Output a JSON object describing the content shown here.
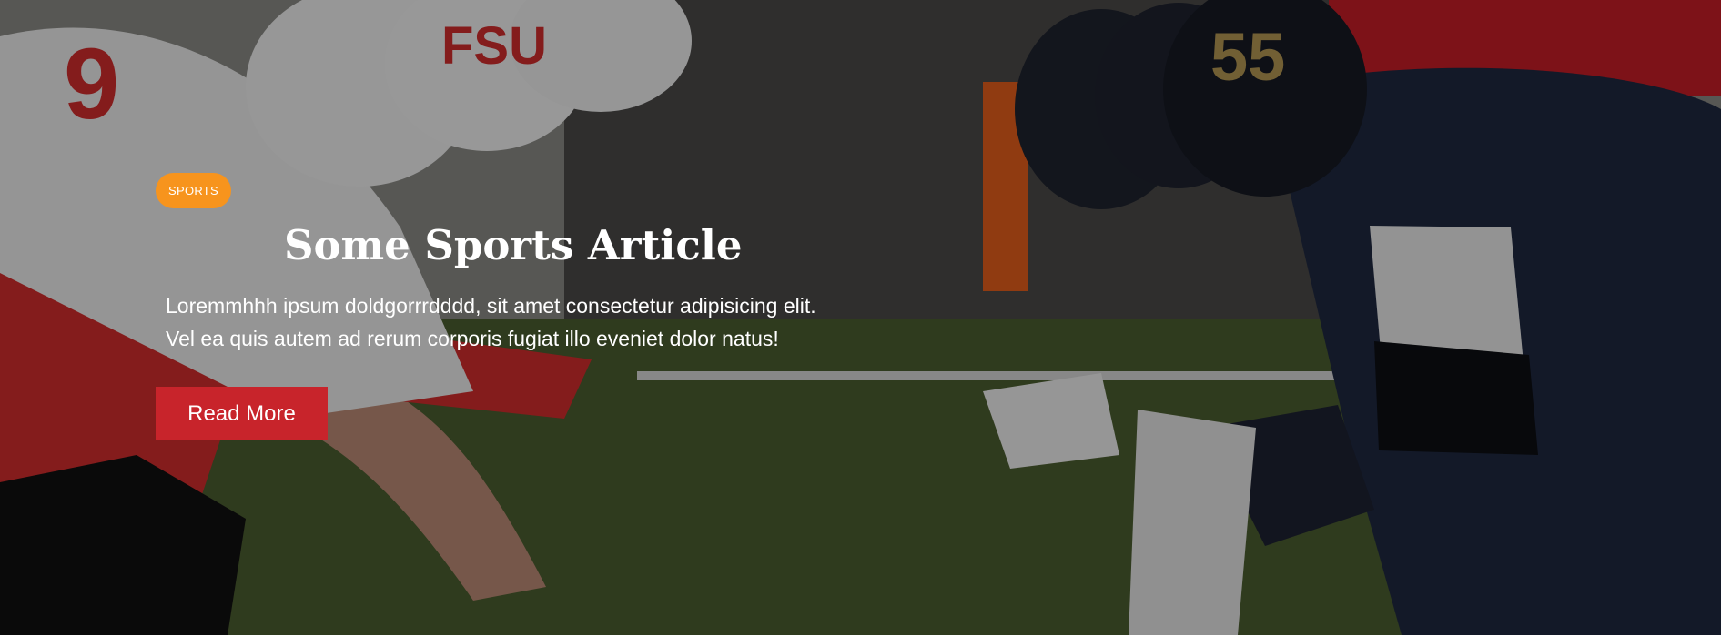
{
  "hero": {
    "category_badge": "SPORTS",
    "title": "Some Sports Article",
    "excerpt_line_1": "Loremmhhh ipsum doldgorrrdddd, sit amet consectetur adipisicing elit.",
    "excerpt_line_2": "Vel ea quis autem ad rerum corporis fugiat illo eveniet dolor natus!",
    "cta_label": "Read More",
    "left_helmet_text": "FSU",
    "right_helmet_number": "55",
    "left_jersey_number": "9"
  },
  "colors": {
    "badge": "#f7941d",
    "button": "#c8242b",
    "field": "#4d5f31",
    "left_team_primary": "#f1f1f1",
    "left_team_accent": "#d62e2e",
    "right_team_primary": "#1f2942",
    "right_team_accent": "#b79a55"
  }
}
